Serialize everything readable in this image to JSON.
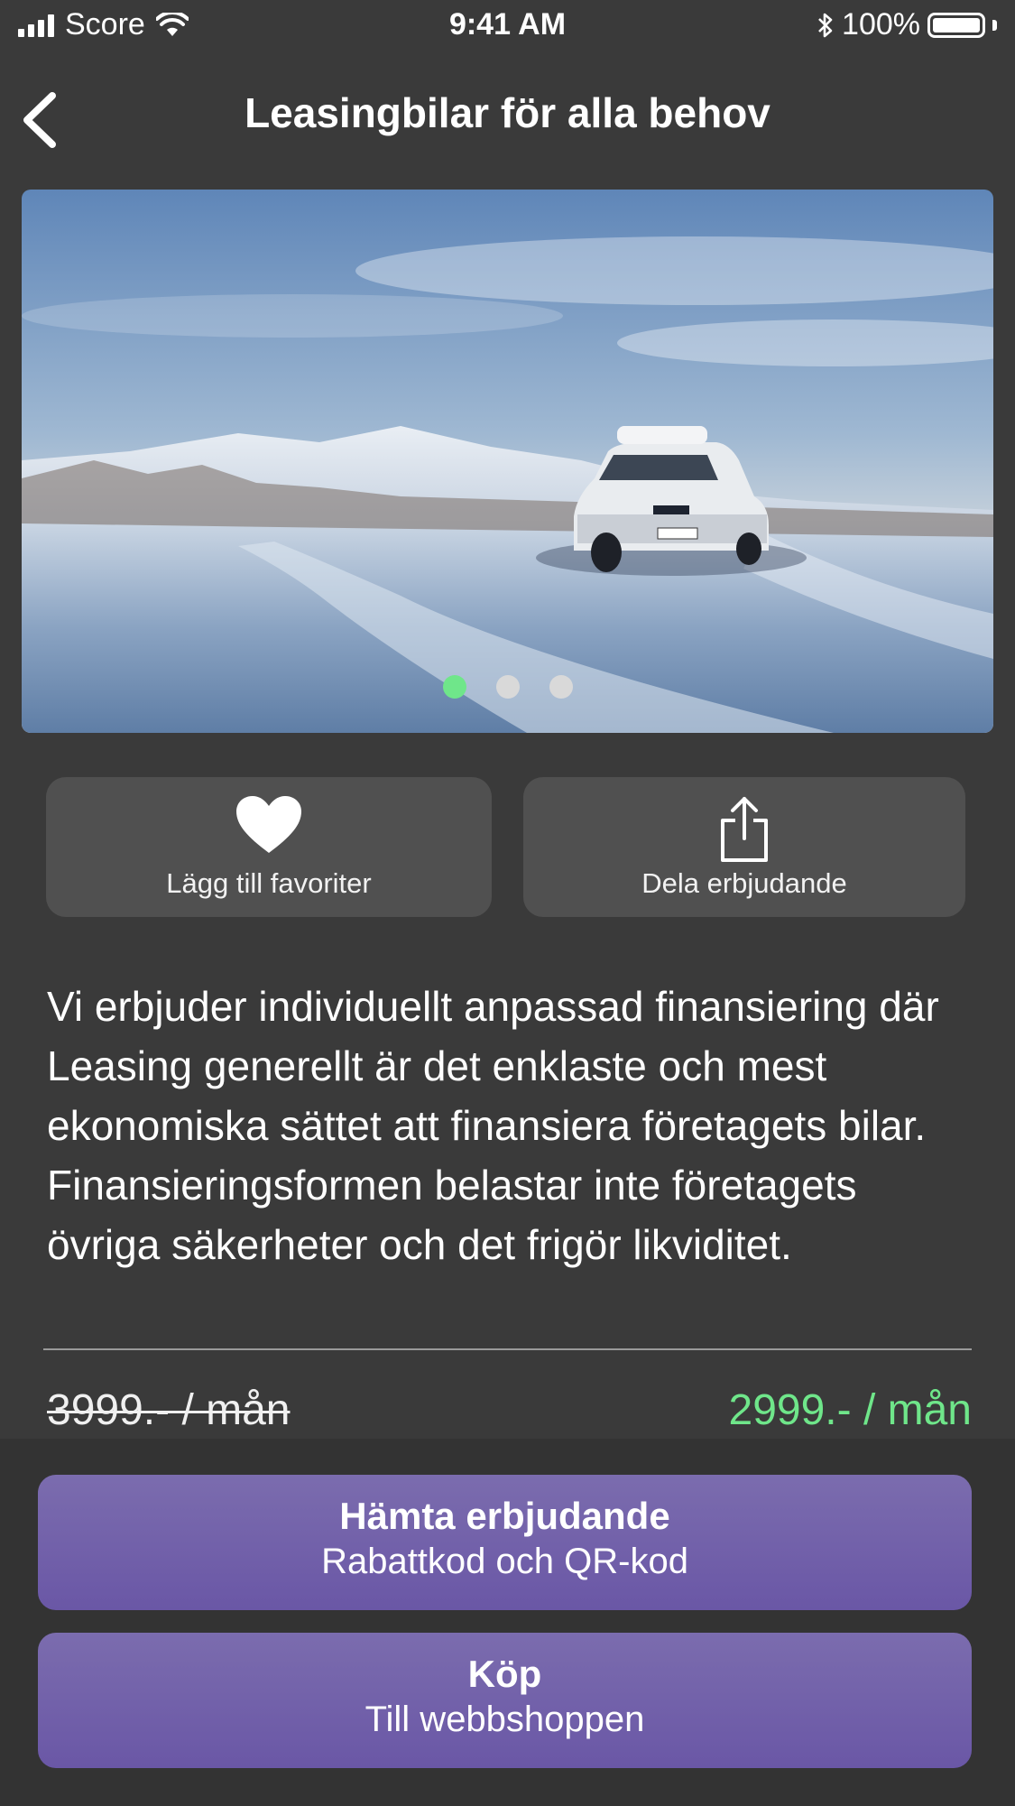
{
  "status_bar": {
    "carrier": "Score",
    "time": "9:41 AM",
    "battery": "100%",
    "battery_level": 1.0
  },
  "nav": {
    "title": "Leasingbilar för alla behov",
    "back_icon": "chevron-left-icon"
  },
  "hero": {
    "slides_count": 3,
    "active_slide": 0,
    "accent_color": "#6fe68a"
  },
  "actions": {
    "favorite": {
      "label": "Lägg till favoriter",
      "icon": "heart-icon"
    },
    "share": {
      "label": "Dela erbjudande",
      "icon": "share-icon"
    }
  },
  "description": "Vi erbjuder individuellt anpassad finansiering där Leasing generellt är det enklaste och mest ekonomiska sättet att finansiera företagets bilar. Finansieringsformen belastar inte företagets övriga säkerheter och det frigör likviditet.",
  "price": {
    "old": "3999.- / mån",
    "new": "2999.- / mån",
    "new_color": "#6fe68a"
  },
  "cta": {
    "offer": {
      "title": "Hämta erbjudande",
      "subtitle": "Rabattkod och QR-kod"
    },
    "buy": {
      "title": "Köp",
      "subtitle": "Till webbshoppen"
    },
    "color": "#6d5ba8"
  }
}
